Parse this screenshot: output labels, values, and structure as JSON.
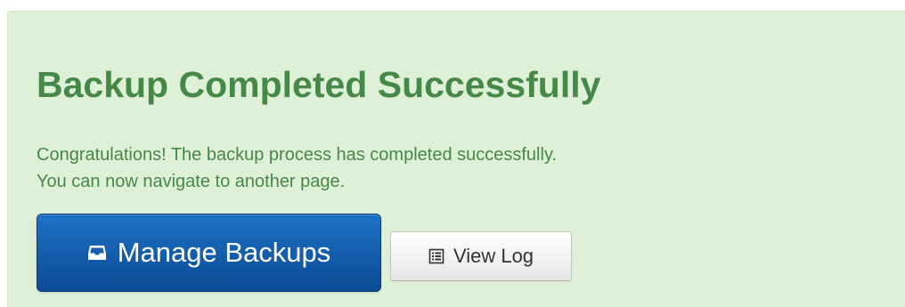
{
  "alert": {
    "title": "Backup Completed Successfully",
    "line1": "Congratulations! The backup process has completed successfully.",
    "line2": "You can now navigate to another page."
  },
  "buttons": {
    "manage_backups": {
      "label": "Manage Backups",
      "icon": "inbox-icon"
    },
    "view_log": {
      "label": "View Log",
      "icon": "list-alt-icon"
    }
  },
  "colors": {
    "alert_background": "#dff0d8",
    "alert_text": "#468847",
    "primary_button": "#0c4a94",
    "default_button": "#f5f5f5"
  }
}
